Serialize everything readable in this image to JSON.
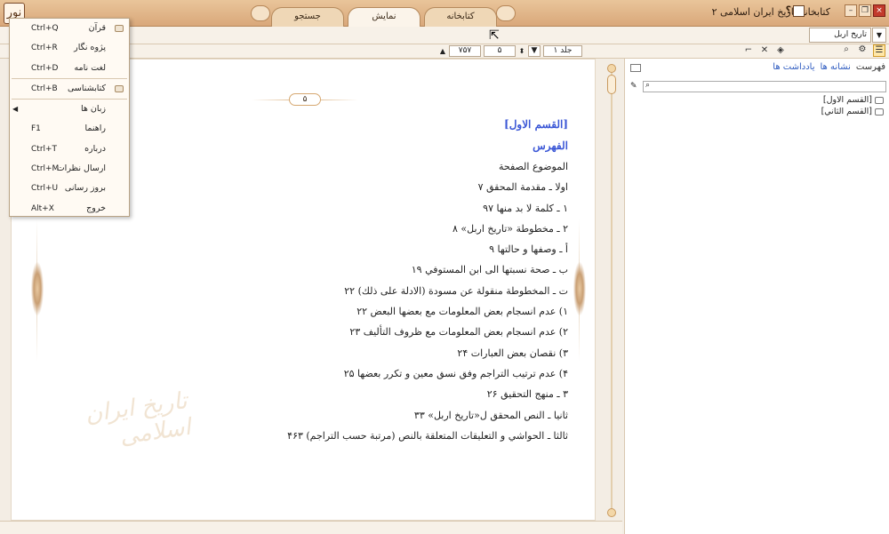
{
  "app": {
    "title": "کتابخانه تاریخ ایران اسلامی ۲",
    "logo_text": "نور",
    "help_glyph": "؟"
  },
  "tabs": [
    {
      "label": "جستجو"
    },
    {
      "label": "نمایش"
    },
    {
      "label": "کتابخانه"
    }
  ],
  "toolbar": {
    "book_select": "تاریخ اربل"
  },
  "nav": {
    "total_pages": "۷۵۷",
    "current_page": "۵",
    "volume": "جلد ۱"
  },
  "menu": {
    "items": [
      {
        "label": "قرآن",
        "shortcut": "Ctrl+Q"
      },
      {
        "label": "پژوه نگار",
        "shortcut": "Ctrl+R"
      },
      {
        "label": "لغت نامه",
        "shortcut": "Ctrl+D"
      },
      {
        "label": "کتابشناسی",
        "shortcut": "Ctrl+B"
      },
      {
        "label": "زبان ها",
        "shortcut": ""
      },
      {
        "label": "راهنما",
        "shortcut": "F1"
      },
      {
        "label": "درباره",
        "shortcut": "Ctrl+T"
      },
      {
        "label": "ارسال نظرات",
        "shortcut": "Ctrl+M"
      },
      {
        "label": "بروز رسانی",
        "shortcut": "Ctrl+U"
      },
      {
        "label": "خروج",
        "shortcut": "Alt+X"
      }
    ]
  },
  "page": {
    "page_number": "۵",
    "watermark": "تاریخ ایران اسلامی",
    "section_heading": "[القسم الاول]",
    "index_heading": "الفهرس",
    "lines": [
      "الموضوع الصفحة",
      "اولا ـ مقدمة المحقق ۷",
      "۱ ـ كلمة لا بد منها ۹۷",
      "۲ ـ مخطوطة «تاريخ اربل» ۸",
      "أ ـ وصفها و حالتها ۹",
      "ب ـ صحة نسبتها الى ابن المستوفي ۱۹",
      "ت ـ المخطوطة منقولة عن مسودة (الادلة على ذلك) ۲۲",
      "۱) عدم انسجام بعض المعلومات مع بعضها البعض ۲۲",
      "۲) عدم انسجام بعض المعلومات مع ظروف التأليف ۲۳",
      "۳) نقصان بعض العبارات ۲۴",
      "۴) عدم ترتيب التراجم وفق نسق معين و تكرر بعضها ۲۵",
      "۳ ـ منهج التحقيق ۲۶",
      "ثانيا ـ النص المحقق ل«تاريخ اربل» ۳۳",
      "ثالثا ـ الحواشي و التعليقات المتعلقة بالنص (مرتبة حسب التراجم) ۴۶۳"
    ]
  },
  "right_panel": {
    "tabs": [
      "فهرست",
      "نشانه ها",
      "یادداشت ها"
    ],
    "tree": [
      "[القسم الاول]",
      "[القسم الثاني]"
    ]
  },
  "colors": {
    "titlebar": "#d9a87a",
    "accent_link": "#2f5cc0",
    "heading_blue": "#3b57d6"
  }
}
